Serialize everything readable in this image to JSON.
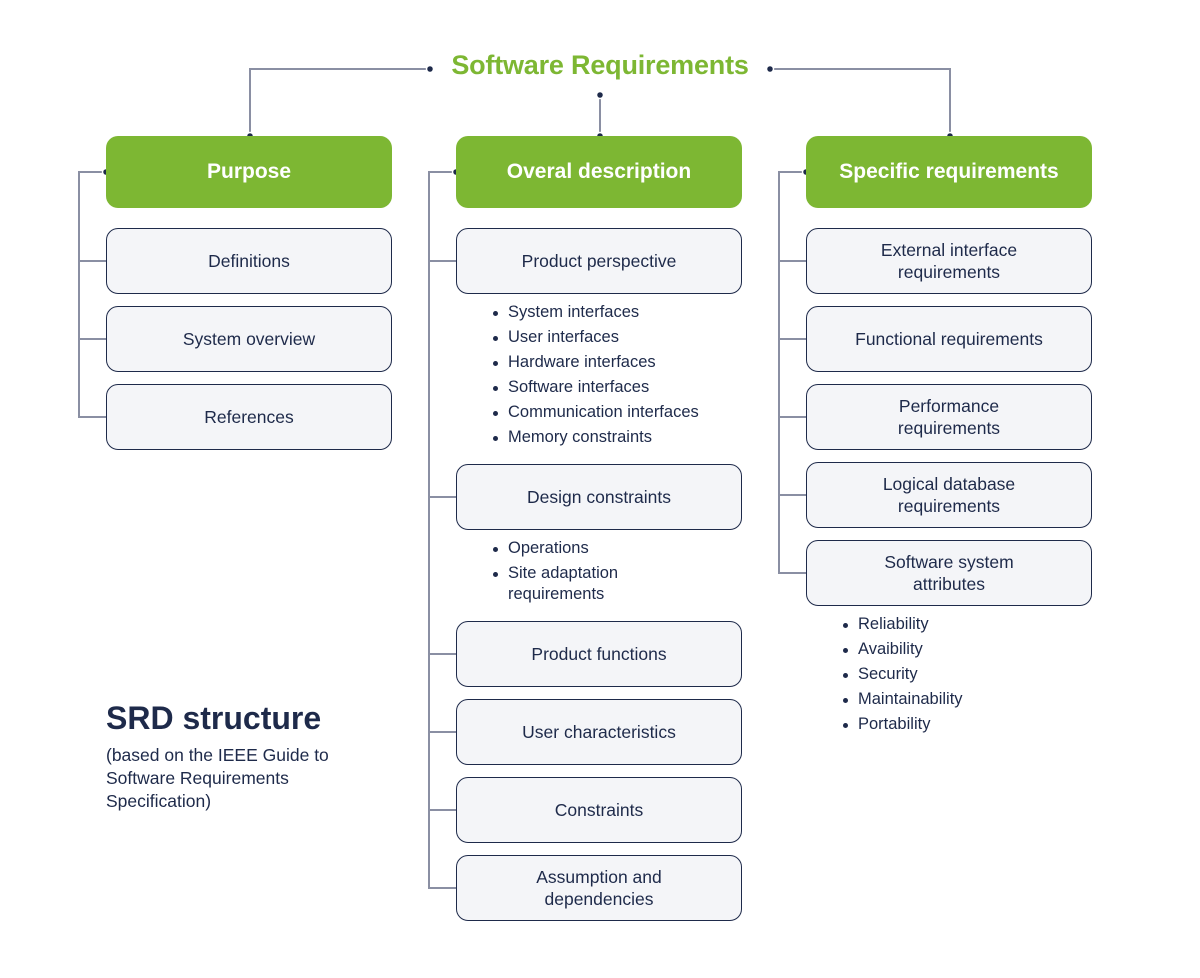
{
  "title": "Software Requirements",
  "colors": {
    "accent": "#7db733",
    "text": "#1e2a4a",
    "box_fill": "#f4f5f8",
    "connector": "#8a8fa3"
  },
  "columns": [
    {
      "header": "Purpose",
      "items": [
        {
          "label": "Definitions"
        },
        {
          "label": "System overview"
        },
        {
          "label": "References"
        }
      ]
    },
    {
      "header": "Overal description",
      "items": [
        {
          "label": "Product perspective",
          "bullets": [
            "System interfaces",
            "User interfaces",
            "Hardware interfaces",
            "Software interfaces",
            "Communication interfaces",
            "Memory constraints"
          ]
        },
        {
          "label": "Design constraints",
          "bullets": [
            "Operations",
            "Site adaptation requirements"
          ]
        },
        {
          "label": "Product functions"
        },
        {
          "label": "User characteristics"
        },
        {
          "label": "Constraints"
        },
        {
          "label": "Assumption and dependencies"
        }
      ]
    },
    {
      "header": "Specific requirements",
      "items": [
        {
          "label": "External interface requirements"
        },
        {
          "label": "Functional requirements"
        },
        {
          "label": "Performance requirements"
        },
        {
          "label": "Logical database requirements"
        },
        {
          "label": "Software system attributes",
          "bullets": [
            "Reliability",
            "Avaibility",
            "Security",
            "Maintainability",
            "Portability"
          ]
        }
      ]
    }
  ],
  "caption": {
    "title": "SRD structure",
    "subtitle": "(based on the IEEE Guide to Software Requirements Specification)"
  }
}
